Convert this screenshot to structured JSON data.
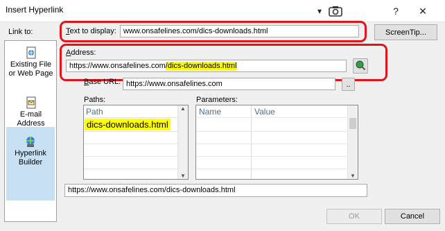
{
  "window": {
    "title": "Insert Hyperlink",
    "help": "?",
    "close": "✕",
    "menu_caret": "▾"
  },
  "link_to": {
    "label": "Link to:"
  },
  "sidebar": {
    "items": [
      {
        "label": "Existing File or Web Page"
      },
      {
        "label": "E-mail Address"
      },
      {
        "label": "Hyperlink Builder"
      }
    ]
  },
  "text_to_display": {
    "label_u": "T",
    "label_rest": "ext to display:",
    "value": "www.onsafelines.com/dics-downloads.html"
  },
  "screentip": {
    "label": "ScreenTip..."
  },
  "address": {
    "label_u": "A",
    "label_rest": "ddress:",
    "value_plain": "https://www.onsafelines.com",
    "value_highlight": "/dics-downloads.html"
  },
  "base_url": {
    "label_u": "B",
    "label_rest": "ase URL:",
    "value": "https://www.onsafelines.com",
    "browse": ".."
  },
  "paths": {
    "label": "Paths:",
    "header": "Path",
    "items": [
      "dics-downloads.html"
    ]
  },
  "parameters": {
    "label": "Parameters:",
    "headers": [
      "Name",
      "Value"
    ]
  },
  "result_url": "https://www.onsafelines.com/dics-downloads.html",
  "buttons": {
    "ok": "OK",
    "cancel": "Cancel"
  },
  "colors": {
    "highlight": "#ffff00",
    "annotation_red": "#e1141c"
  }
}
